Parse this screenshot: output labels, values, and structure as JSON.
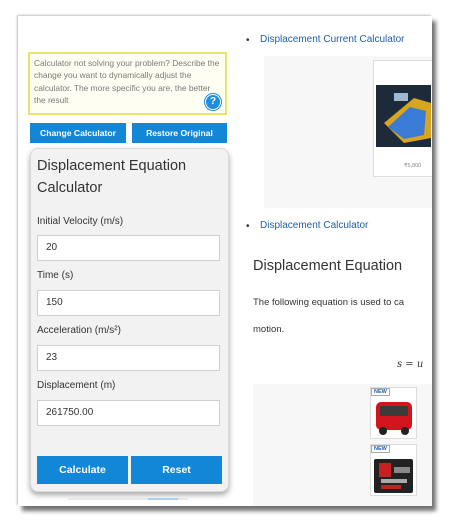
{
  "left": {
    "prompt_text": "Calculator not solving your problem? Describe the change you want to dynamically adjust the calculator. The more specific you are, the better the result",
    "help_glyph": "?",
    "change_button": "Change Calculator",
    "restore_button": "Restore Original",
    "calculator": {
      "title": "Displacement Equation Calculator",
      "fields": [
        {
          "label": "Initial Velocity (m/s)",
          "value": "20"
        },
        {
          "label": "Time (s)",
          "value": "150"
        },
        {
          "label": "Acceleration (m/s²)",
          "value": "23"
        },
        {
          "label": "Displacement (m)",
          "value": "261750.00"
        }
      ],
      "calculate_button": "Calculate",
      "reset_button": "Reset"
    }
  },
  "right": {
    "bullet": "•",
    "link1": "Displacement Current Calculator",
    "link2": "Displacement Calculator",
    "ad_new_badge": "NEW",
    "ad_price": "₹5,800",
    "heading": "Displacement Equation",
    "para_line1": "The following equation is used to ca",
    "para_line2": "motion.",
    "formula": "s = u",
    "colors": {
      "link": "#1f5fa8",
      "button": "#1387d7",
      "highlight_border": "#e8e46a"
    }
  }
}
